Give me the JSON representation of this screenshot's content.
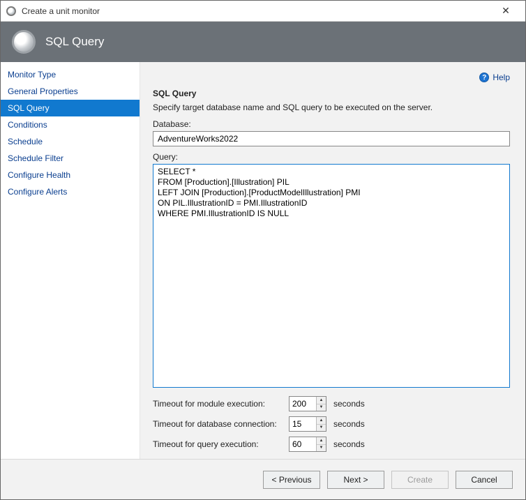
{
  "window": {
    "title": "Create a unit monitor"
  },
  "banner": {
    "title": "SQL Query"
  },
  "sidebar": {
    "items": [
      {
        "label": "Monitor Type",
        "selected": false
      },
      {
        "label": "General Properties",
        "selected": false
      },
      {
        "label": "SQL Query",
        "selected": true
      },
      {
        "label": "Conditions",
        "selected": false
      },
      {
        "label": "Schedule",
        "selected": false
      },
      {
        "label": "Schedule Filter",
        "selected": false
      },
      {
        "label": "Configure Health",
        "selected": false
      },
      {
        "label": "Configure Alerts",
        "selected": false
      }
    ]
  },
  "help": {
    "label": "Help"
  },
  "section": {
    "title": "SQL Query",
    "description": "Specify target database name and SQL query to be executed on the server."
  },
  "database": {
    "label": "Database:",
    "value": "AdventureWorks2022"
  },
  "query": {
    "label": "Query:",
    "value": "SELECT *\nFROM [Production].[Illustration] PIL\nLEFT JOIN [Production].[ProductModelIllustration] PMI\nON PIL.IllustrationID = PMI.IllustrationID\nWHERE PMI.IllustrationID IS NULL"
  },
  "timeouts": {
    "module": {
      "label": "Timeout for module execution:",
      "value": "200",
      "unit": "seconds"
    },
    "database": {
      "label": "Timeout for database connection:",
      "value": "15",
      "unit": "seconds"
    },
    "query": {
      "label": "Timeout for query execution:",
      "value": "60",
      "unit": "seconds"
    }
  },
  "footer": {
    "previous": "< Previous",
    "next": "Next >",
    "create": "Create",
    "cancel": "Cancel"
  }
}
